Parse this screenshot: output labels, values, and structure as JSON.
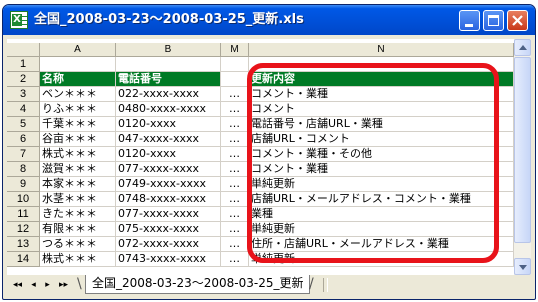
{
  "window": {
    "title": "全国_2008-03-23～2008-03-25_更新.xls",
    "controls": [
      "minimize",
      "maximize",
      "close"
    ]
  },
  "sheet": {
    "columns": [
      "A",
      "B",
      "M",
      "N"
    ],
    "rows": [
      {
        "num": "1",
        "a": "",
        "b": "",
        "m": "",
        "n": ""
      },
      {
        "num": "2",
        "a": "名称",
        "b": "電話番号",
        "m": "",
        "n": "更新内容",
        "header": true
      },
      {
        "num": "3",
        "a": "ベン＊＊＊",
        "b": "022-xxxx-xxxx",
        "m": "…",
        "n": "コメント・業種"
      },
      {
        "num": "4",
        "a": "りふ＊＊＊",
        "b": "0480-xxxx-xxxx",
        "m": "…",
        "n": "コメント"
      },
      {
        "num": "5",
        "a": "千葉＊＊＊",
        "b": "0120-xxxx",
        "m": "…",
        "n": "電話番号・店舗URL・業種"
      },
      {
        "num": "6",
        "a": "谷亩＊＊＊",
        "b": "047-xxxx-xxxx",
        "m": "…",
        "n": "店舗URL・コメント"
      },
      {
        "num": "7",
        "a": "株式＊＊＊",
        "b": "0120-xxxx",
        "m": "…",
        "n": "コメント・業種・その他"
      },
      {
        "num": "8",
        "a": "滋賀＊＊＊",
        "b": "077-xxxx-xxxx",
        "m": "…",
        "n": "コメント・業種"
      },
      {
        "num": "9",
        "a": "本家＊＊＊",
        "b": "0749-xxxx-xxxx",
        "m": "…",
        "n": "単純更新"
      },
      {
        "num": "10",
        "a": "水茎＊＊＊",
        "b": "0748-xxxx-xxxx",
        "m": "…",
        "n": "店舗URL・メールアドレス・コメント・業種"
      },
      {
        "num": "11",
        "a": "きた＊＊＊",
        "b": "077-xxxx-xxxx",
        "m": "…",
        "n": "業種"
      },
      {
        "num": "12",
        "a": "有限＊＊＊",
        "b": "075-xxxx-xxxx",
        "m": "…",
        "n": "単純更新"
      },
      {
        "num": "13",
        "a": "つる＊＊＊",
        "b": "072-xxxx-xxxx",
        "m": "…",
        "n": "住所・店舗URL・メールアドレス・業種"
      },
      {
        "num": "14",
        "a": "株式＊＊＊",
        "b": "0743-xxxx-xxxx",
        "m": "…",
        "n": "単純更新"
      }
    ]
  },
  "tabs": {
    "nav": [
      "◂◂",
      "◂",
      "▸",
      "▸▸"
    ],
    "active_label": "全国_2008-03-23～2008-03-25_更新"
  },
  "colors": {
    "header_green": "#007a25",
    "highlight_red": "#e8131a",
    "titlebar_blue": "#0054e3"
  }
}
